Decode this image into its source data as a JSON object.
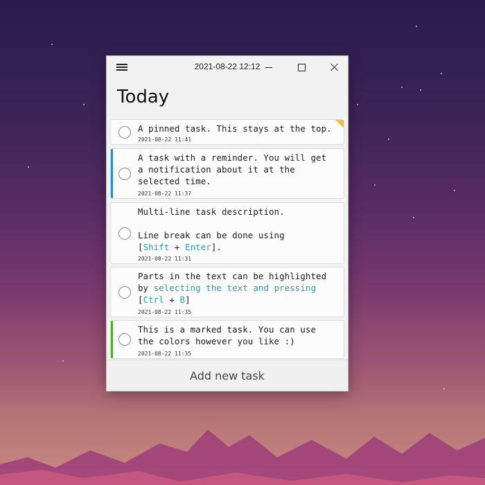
{
  "window": {
    "title": "2021-08-22 12:12"
  },
  "view": {
    "heading": "Today"
  },
  "tasks": [
    {
      "segments": [
        {
          "t": "A pinned task. This stays at the top.",
          "hl": false
        }
      ],
      "time": "2021-08-22 11:41",
      "pinned": true,
      "accent": null
    },
    {
      "segments": [
        {
          "t": "A task with a reminder. You will get\na notification about it at the\nselected time.",
          "hl": false
        }
      ],
      "time": "2021-08-22 11:37",
      "pinned": false,
      "accent": "#1e8fd6"
    },
    {
      "segments": [
        {
          "t": "Multi-line task description.\n\nLine break can be done using\n[",
          "hl": false
        },
        {
          "t": "Shift",
          "hl": true
        },
        {
          "t": " + ",
          "hl": false
        },
        {
          "t": "Enter",
          "hl": true
        },
        {
          "t": "].",
          "hl": false
        }
      ],
      "time": "2021-08-22 11:31",
      "pinned": false,
      "accent": null
    },
    {
      "segments": [
        {
          "t": "Parts in the text can be highlighted\nby ",
          "hl": false
        },
        {
          "t": "selecting the text and pressing",
          "hl": true
        },
        {
          "t": "\n[",
          "hl": false
        },
        {
          "t": "Ctrl",
          "hl": true
        },
        {
          "t": " + ",
          "hl": false
        },
        {
          "t": "B",
          "hl": true
        },
        {
          "t": "]",
          "hl": false
        }
      ],
      "time": "2021-08-22 11:35",
      "pinned": false,
      "accent": null
    },
    {
      "segments": [
        {
          "t": "This is a marked task. You can use\nthe colors however you like :)",
          "hl": false
        }
      ],
      "time": "2021-08-22 11:35",
      "pinned": false,
      "accent": "#4caf22"
    }
  ],
  "footer": {
    "add_label": "Add new task"
  },
  "colors": {
    "highlight": "#2f97b8",
    "pin_corner": "#f2c230"
  }
}
